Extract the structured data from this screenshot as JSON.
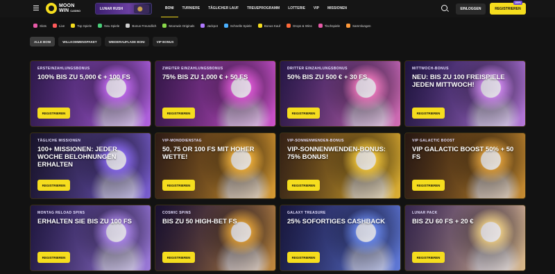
{
  "header": {
    "logo_line1": "MOON",
    "logo_line2": "WIN",
    "logo_small": "CASINO",
    "promo_banner": "LUNAR RUSH",
    "nav": [
      "BONI",
      "TURNIERE",
      "TÄGLICHER LAUF",
      "TREUEPROGRAMM",
      "LOTTERIE",
      "VIP",
      "MISSIONEN"
    ],
    "login": "EINLOGGEN",
    "register": "REGISTRIEREN",
    "register_badge": "100%"
  },
  "categories": [
    {
      "label": "Slots",
      "color": "#e85aa8"
    },
    {
      "label": "Live",
      "color": "#ff5a5a"
    },
    {
      "label": "Top Spiele",
      "color": "#f5dd1e"
    },
    {
      "label": "Neu Spiele",
      "color": "#4ad07a"
    },
    {
      "label": "Bonus Freundlich",
      "color": "#cfcfcf"
    },
    {
      "label": "Moonwin Originals",
      "color": "#8ad94a"
    },
    {
      "label": "Jackpot",
      "color": "#b07aff"
    },
    {
      "label": "Schnelle Spiele",
      "color": "#4ab0ff"
    },
    {
      "label": "Bonus Kauf",
      "color": "#f5dd1e"
    },
    {
      "label": "Drops & Wins",
      "color": "#ff6a3a"
    },
    {
      "label": "Tischspiele",
      "color": "#e85aa8"
    },
    {
      "label": "Sammlungen",
      "color": "#ff9a3a"
    }
  ],
  "filters": [
    "ALLE BONI",
    "WILLKOMMENSPAKET",
    "WIEDERAUFLADE BONI",
    "VIP BONUS"
  ],
  "cards": [
    {
      "label": "ERSTEINZAHLUNGSBONUS",
      "headline": "100% BIS ZU 5,000 € + 100 FS",
      "cta": "REGISTRIEREN",
      "bg": "#5a2e8a",
      "accent": "#c46cf2"
    },
    {
      "label": "ZWEITER EINZAHLUNGSBONUS",
      "headline": "75% BIS ZU 1,000 € + 50 FS",
      "cta": "REGISTRIEREN",
      "bg": "#6a2a86",
      "accent": "#e05ad8"
    },
    {
      "label": "DRITTER EINZAHLUNGSBONUS",
      "headline": "50% BIS ZU 500 € + 30 FS",
      "cta": "REGISTRIEREN",
      "bg": "#4a2a80",
      "accent": "#f07ac0"
    },
    {
      "label": "MITTWOCH-BONUS",
      "headline": "NEU: BIS ZU 100 FREISPIELE JEDEN MITTWOCH!",
      "cta": "REGISTRIEREN",
      "bg": "#3a2470",
      "accent": "#d08af0"
    },
    {
      "label": "TÄGLICHE MISSIONEN",
      "headline": "100+ MISSIONEN: JEDER WOCHE BELOHNUNGEN ERHALTEN",
      "cta": "REGISTRIEREN",
      "bg": "#2a2240",
      "accent": "#8a6af0"
    },
    {
      "label": "VIP-MONDDIENSTAG",
      "headline": "50, 75 OR 100 FS MIT HOHER WETTE!",
      "cta": "REGISTRIEREN",
      "bg": "#5a3410",
      "accent": "#f0b03a"
    },
    {
      "label": "VIP-SONNENWENDEN-BONUS",
      "headline": "VIP-SONNENWENDEN-BONUS: 75% BONUS!",
      "cta": "REGISTRIEREN",
      "bg": "#6a4010",
      "accent": "#f5c83a"
    },
    {
      "label": "VIP GALACTIC BOOST",
      "headline": "VIP GALACTIC BOOST 50% + 50 FS",
      "cta": "REGISTRIEREN",
      "bg": "#4a2a0a",
      "accent": "#e0a03a"
    },
    {
      "label": "MONTAG RELOAD SPINS",
      "headline": "ERHALTEN SIE BIS ZU 100 FS",
      "cta": "REGISTRIEREN",
      "bg": "#3a2a70",
      "accent": "#b08af0"
    },
    {
      "label": "COSMIC SPINS",
      "headline": "BIS ZU 50 HIGH-BET FS",
      "cta": "REGISTRIEREN",
      "bg": "#2a1a4a",
      "accent": "#e0a03a"
    },
    {
      "label": "GALAXY TREASURE",
      "headline": "25% SOFORTIGES CASHBACK",
      "cta": "REGISTRIEREN",
      "bg": "#2a2a6a",
      "accent": "#6a8af0"
    },
    {
      "label": "LUNAR PACK",
      "headline": "BIS ZU 60 FS + 20 €",
      "cta": "REGISTRIEREN",
      "bg": "#6a4a8a",
      "accent": "#f0d08a"
    }
  ]
}
